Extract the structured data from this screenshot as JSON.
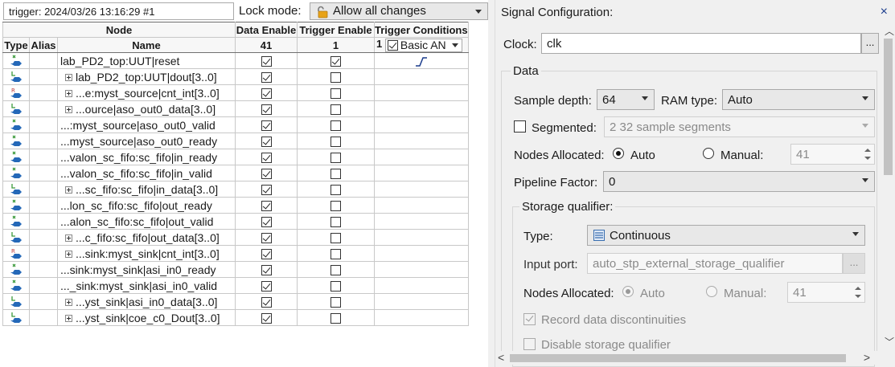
{
  "left": {
    "trigger_label": "trigger: 2024/03/26 13:16:29  #1",
    "lock_mode_label": "Lock mode:",
    "lock_mode_value": "Allow all changes",
    "columns": {
      "node_group": "Node",
      "type": "Type",
      "alias": "Alias",
      "name": "Name",
      "data_enable": "Data Enable",
      "data_enable_count": "41",
      "trigger_enable": "Trigger Enable",
      "trigger_enable_count": "1",
      "trigger_conditions": "Trigger Conditions",
      "trigger_conditions_prefix": "1",
      "trigger_condition_mode": "Basic AN"
    },
    "rows": [
      {
        "name": "lab_PD2_top:UUT|reset",
        "icon": "input-pin-icon",
        "expandable": false,
        "data_enable": true,
        "trigger_enable": true,
        "trigger": "rising-edge-icon"
      },
      {
        "name": "lab_PD2_top:UUT|dout[3..0]",
        "icon": "bus-icon",
        "expandable": true,
        "data_enable": true,
        "trigger_enable": false,
        "trigger": ""
      },
      {
        "name": "...e:myst_source|cnt_int[3..0]",
        "icon": "register-icon",
        "expandable": true,
        "data_enable": true,
        "trigger_enable": false,
        "trigger": ""
      },
      {
        "name": "...ource|aso_out0_data[3..0]",
        "icon": "bus-icon",
        "expandable": true,
        "data_enable": true,
        "trigger_enable": false,
        "trigger": ""
      },
      {
        "name": "...:myst_source|aso_out0_valid",
        "icon": "input-pin-icon",
        "expandable": false,
        "data_enable": true,
        "trigger_enable": false,
        "trigger": ""
      },
      {
        "name": "...myst_source|aso_out0_ready",
        "icon": "input-pin-icon",
        "expandable": false,
        "data_enable": true,
        "trigger_enable": false,
        "trigger": ""
      },
      {
        "name": "...valon_sc_fifo:sc_fifo|in_ready",
        "icon": "input-pin-icon",
        "expandable": false,
        "data_enable": true,
        "trigger_enable": false,
        "trigger": ""
      },
      {
        "name": "...valon_sc_fifo:sc_fifo|in_valid",
        "icon": "input-pin-icon",
        "expandable": false,
        "data_enable": true,
        "trigger_enable": false,
        "trigger": ""
      },
      {
        "name": "...sc_fifo:sc_fifo|in_data[3..0]",
        "icon": "bus-icon",
        "expandable": true,
        "data_enable": true,
        "trigger_enable": false,
        "trigger": ""
      },
      {
        "name": "...lon_sc_fifo:sc_fifo|out_ready",
        "icon": "input-pin-icon",
        "expandable": false,
        "data_enable": true,
        "trigger_enable": false,
        "trigger": ""
      },
      {
        "name": "...alon_sc_fifo:sc_fifo|out_valid",
        "icon": "input-pin-icon",
        "expandable": false,
        "data_enable": true,
        "trigger_enable": false,
        "trigger": ""
      },
      {
        "name": "...c_fifo:sc_fifo|out_data[3..0]",
        "icon": "bus-icon",
        "expandable": true,
        "data_enable": true,
        "trigger_enable": false,
        "trigger": ""
      },
      {
        "name": "...sink:myst_sink|cnt_int[3..0]",
        "icon": "register-icon",
        "expandable": true,
        "data_enable": true,
        "trigger_enable": false,
        "trigger": ""
      },
      {
        "name": "...sink:myst_sink|asi_in0_ready",
        "icon": "input-pin-icon",
        "expandable": false,
        "data_enable": true,
        "trigger_enable": false,
        "trigger": ""
      },
      {
        "name": "..._sink:myst_sink|asi_in0_valid",
        "icon": "input-pin-icon",
        "expandable": false,
        "data_enable": true,
        "trigger_enable": false,
        "trigger": ""
      },
      {
        "name": "...yst_sink|asi_in0_data[3..0]",
        "icon": "bus-icon",
        "expandable": true,
        "data_enable": true,
        "trigger_enable": false,
        "trigger": ""
      },
      {
        "name": "...yst_sink|coe_c0_Dout[3..0]",
        "icon": "bus-icon",
        "expandable": true,
        "data_enable": true,
        "trigger_enable": false,
        "trigger": ""
      }
    ]
  },
  "right": {
    "title": "Signal Configuration:",
    "close_glyph": "×",
    "clock_label": "Clock:",
    "clock_value": "clk",
    "browse_label": "...",
    "data_group_label": "Data",
    "sample_depth_label": "Sample depth:",
    "sample_depth_value": "64",
    "ram_type_label": "RAM type:",
    "ram_type_value": "Auto",
    "segmented_label": "Segmented:",
    "segmented_value": "2  32 sample segments",
    "nodes_allocated_label": "Nodes Allocated:",
    "auto_label": "Auto",
    "manual_label": "Manual:",
    "nodes_allocated_manual_value": "41",
    "pipeline_factor_label": "Pipeline Factor:",
    "pipeline_factor_value": "0",
    "storage_qualifier_label": "Storage qualifier:",
    "sq_type_label": "Type:",
    "sq_type_value": "Continuous",
    "input_port_label": "Input port:",
    "input_port_placeholder": "auto_stp_external_storage_qualifier",
    "sq_nodes_allocated_label": "Nodes Allocated:",
    "sq_auto_label": "Auto",
    "sq_manual_label": "Manual:",
    "sq_manual_value": "41",
    "record_discontinuities_label": "Record data discontinuities",
    "disable_storage_qualifier_label": "Disable storage qualifier"
  },
  "colors": {
    "lock_icon": "#e8a317",
    "pin_green": "#3c9a3c",
    "pin_blue": "#2468b8"
  }
}
